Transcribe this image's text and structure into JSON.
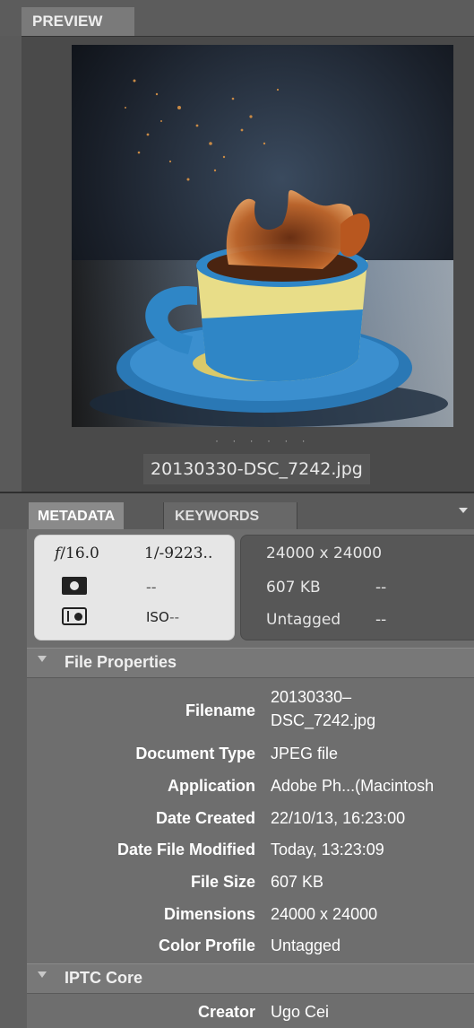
{
  "preview": {
    "tab_label": "PREVIEW",
    "filename": "20130330-DSC_7242.jpg",
    "dots": "· · · · · ·"
  },
  "metadata_tabs": {
    "metadata_label": "METADATA",
    "keywords_label": "KEYWORDS"
  },
  "camera": {
    "aperture_symbol": "f",
    "aperture_value": "/16.0",
    "shutter": "1/-9223..",
    "metering_value": "--",
    "iso_label": "ISO",
    "iso_value": "--"
  },
  "file_summary": {
    "dimensions": "24000 x 24000",
    "size": "607 KB",
    "size_extra": "--",
    "color_profile": "Untagged",
    "color_extra": "--"
  },
  "file_properties": {
    "title": "File Properties",
    "rows": [
      {
        "label": "Filename",
        "value": "20130330–",
        "value2": "DSC_7242.jpg"
      },
      {
        "label": "Document Type",
        "value": "JPEG file"
      },
      {
        "label": "Application",
        "value": "Adobe Ph...(Macintosh"
      },
      {
        "label": "Date Created",
        "value": "22/10/13, 16:23:00"
      },
      {
        "label": "Date File Modified",
        "value": "Today, 13:23:09"
      },
      {
        "label": "File Size",
        "value": "607 KB"
      },
      {
        "label": "Dimensions",
        "value": "24000 x 24000"
      },
      {
        "label": "Color Profile",
        "value": "Untagged"
      }
    ]
  },
  "iptc_core": {
    "title": "IPTC Core",
    "rows": [
      {
        "label": "Creator",
        "value": "Ugo Cei"
      }
    ]
  }
}
